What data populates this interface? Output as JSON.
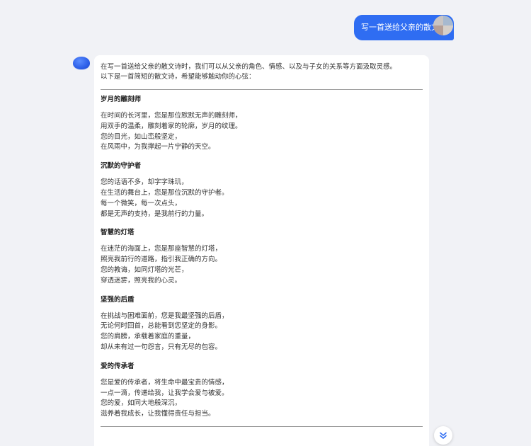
{
  "user_message": {
    "text": "写一首送给父亲的散文诗"
  },
  "answer": {
    "intro_lines": [
      "在写一首送给父亲的散文诗时，我们可以从父亲的角色、情感、以及与子女的关系等方面汲取灵感。",
      "以下是一首简短的散文诗，希望能够触动你的心弦："
    ],
    "sections": [
      {
        "title": "岁月的雕刻师",
        "lines": [
          "在时间的长河里，您是那位默默无声的雕刻师，",
          "用双手的温柔，雕刻着家的轮廓，岁月的纹理。",
          "您的目光，如山峦般坚定，",
          "在风雨中，为我撑起一片宁静的天空。"
        ]
      },
      {
        "title": "沉默的守护者",
        "lines": [
          "您的话语不多，却字字珠玑，",
          "在生活的舞台上，您是那位沉默的守护者。",
          "每一个微笑，每一次点头，",
          "都是无声的支持，是我前行的力量。"
        ]
      },
      {
        "title": "智慧的灯塔",
        "lines": [
          "在迷茫的海面上，您是那座智慧的灯塔，",
          "照亮我前行的道路，指引我正确的方向。",
          "您的教诲，如同灯塔的光芒，",
          "穿透迷雾，照亮我的心灵。"
        ]
      },
      {
        "title": "坚强的后盾",
        "lines": [
          "在挑战与困难面前，您是我最坚强的后盾，",
          "无论何时回首，总能看到您坚定的身影。",
          "您的肩膀，承载着家庭的重量，",
          "却从未有过一句怨言，只有无尽的包容。"
        ]
      },
      {
        "title": "爱的传承者",
        "lines": [
          "您是爱的传承者，将生命中最宝贵的情感，",
          "一点一滴，传递给我，让我学会爱与被爱。",
          "您的爱，如同大地般深沉，",
          "滋养着我成长，让我懂得责任与担当。"
        ]
      }
    ]
  },
  "icons": {
    "bot_avatar": "bot-avatar-icon",
    "user_avatar": "user-avatar-icon",
    "scroll_down": "double-chevron-down-icon"
  },
  "colors": {
    "accent": "#2f6df2",
    "background": "#f1f2f6",
    "card": "#ffffff",
    "text": "#333333"
  }
}
